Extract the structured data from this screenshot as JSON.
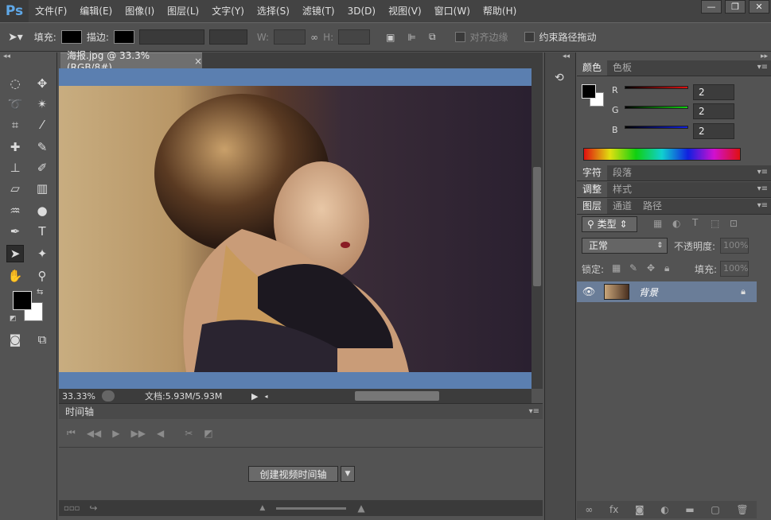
{
  "app": {
    "logo": "Ps"
  },
  "menu": [
    "文件(F)",
    "编辑(E)",
    "图像(I)",
    "图层(L)",
    "文字(Y)",
    "选择(S)",
    "滤镜(T)",
    "3D(D)",
    "视图(V)",
    "窗口(W)",
    "帮助(H)"
  ],
  "window_controls": {
    "minimize": "—",
    "restore": "❐",
    "close": "✕"
  },
  "options_bar": {
    "fill_label": "填充:",
    "stroke_label": "描边:",
    "w_label": "W:",
    "h_label": "H:",
    "align_edges": "对齐边缘",
    "constrain_path": "约束路径拖动"
  },
  "document": {
    "tab_title": "海报.jpg @ 33.3%(RGB/8#)",
    "close": "×"
  },
  "status": {
    "zoom": "33.33%",
    "doc_size": "文档:5.93M/5.93M"
  },
  "timeline": {
    "title": "时间轴",
    "create_button": "创建视频时间轴"
  },
  "panels": {
    "color_tabs": [
      "颜色",
      "色板"
    ],
    "rgb": [
      {
        "label": "R",
        "value": "2"
      },
      {
        "label": "G",
        "value": "2"
      },
      {
        "label": "B",
        "value": "2"
      }
    ],
    "char_tabs": [
      "字符",
      "段落"
    ],
    "adjust_tabs": [
      "调整",
      "样式"
    ],
    "layer_tabs": [
      "图层",
      "通道",
      "路径"
    ],
    "kind_filter": "类型",
    "blend_mode": "正常",
    "opacity_label": "不透明度:",
    "opacity_value": "100%",
    "lock_label": "锁定:",
    "fill_label": "填充:",
    "fill_value": "100%",
    "layer_name": "背景"
  },
  "colors": {
    "accent": "#5b7fb0",
    "layer_selected": "#6a7d98"
  }
}
